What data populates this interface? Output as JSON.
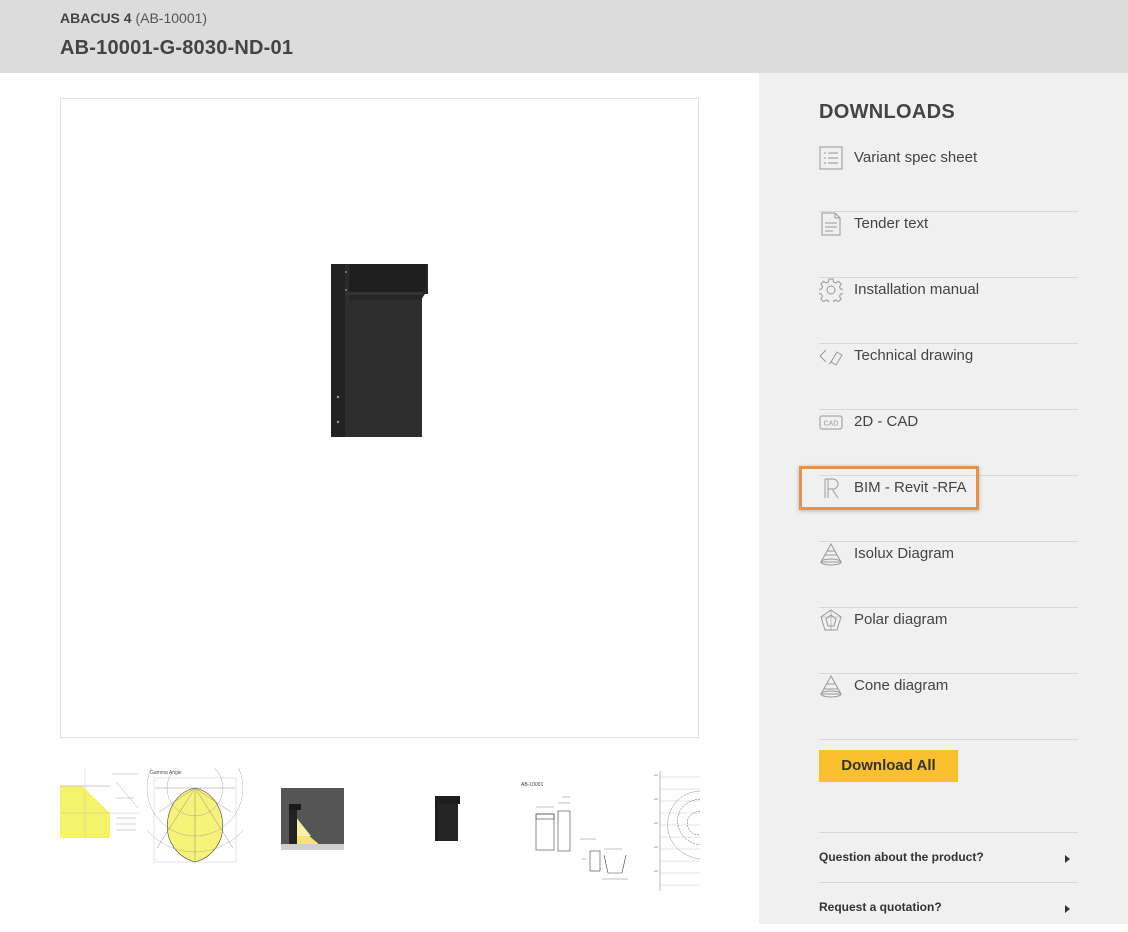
{
  "header": {
    "family_name": "ABACUS 4",
    "family_code": "(AB-10001)",
    "variant_code": "AB-10001-G-8030-ND-01"
  },
  "downloads": {
    "title": "DOWNLOADS",
    "items": [
      {
        "label": "Variant spec sheet",
        "icon": "list-document-icon"
      },
      {
        "label": "Tender text",
        "icon": "text-document-icon"
      },
      {
        "label": "Installation manual",
        "icon": "gear-icon"
      },
      {
        "label": "Technical drawing",
        "icon": "technical-drawing-icon"
      },
      {
        "label": "2D - CAD",
        "icon": "cad-icon"
      },
      {
        "label": "BIM - Revit -RFA",
        "icon": "revit-icon"
      },
      {
        "label": "Isolux Diagram",
        "icon": "isolux-icon"
      },
      {
        "label": "Polar diagram",
        "icon": "polar-icon"
      },
      {
        "label": "Cone diagram",
        "icon": "cone-icon"
      }
    ],
    "download_all_label": "Download All"
  },
  "faq": [
    {
      "label": "Question about the product?"
    },
    {
      "label": "Request a quotation?"
    }
  ],
  "thumbnails": [
    {
      "name": "isolux-thumbnail"
    },
    {
      "name": "polar-thumbnail"
    },
    {
      "name": "lit-photo-thumbnail"
    },
    {
      "name": "product-thumbnail"
    },
    {
      "name": "technical-drawing-thumbnail"
    },
    {
      "name": "isolux-grid-thumbnail"
    }
  ],
  "thumb_text": {
    "gamma_label": "Gamma Angle",
    "drawing_code": "AB-10001"
  },
  "colors": {
    "accent": "#fbc02d",
    "highlight": "#e8914a",
    "header_bg": "#dcdcdc",
    "sidebar_bg": "#f0f0f0"
  }
}
